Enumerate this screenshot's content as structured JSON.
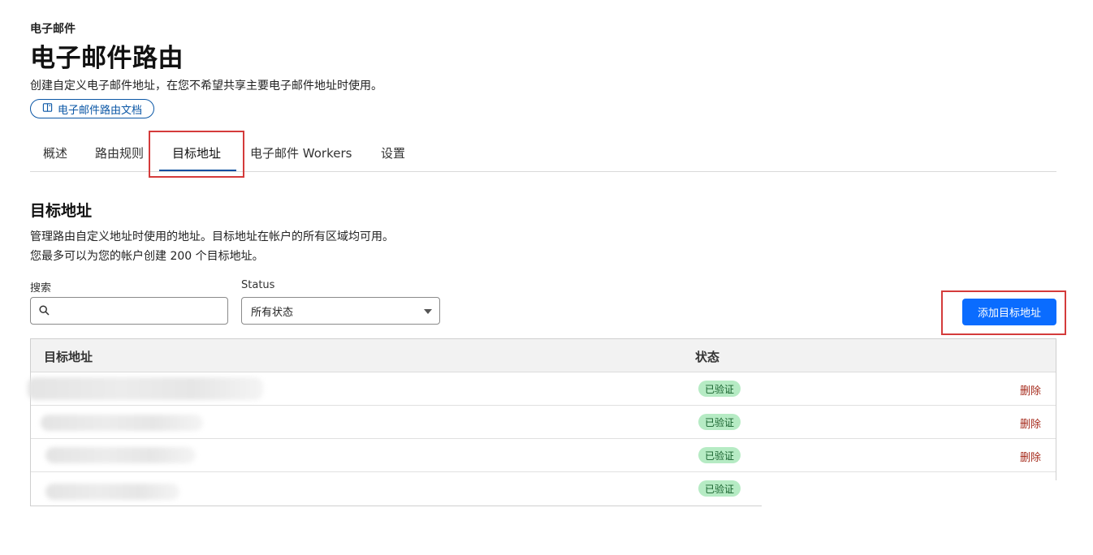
{
  "breadcrumb": "电子邮件",
  "title": "电子邮件路由",
  "description": "创建自定义电子邮件地址，在您不希望共享主要电子邮件地址时使用。",
  "docs_link": {
    "label": "电子邮件路由文档",
    "icon": "book-icon"
  },
  "tabs": [
    {
      "label": "概述",
      "active": false
    },
    {
      "label": "路由规则",
      "active": false
    },
    {
      "label": "目标地址",
      "active": true
    },
    {
      "label": "电子邮件 Workers",
      "active": false
    },
    {
      "label": "设置",
      "active": false
    }
  ],
  "section": {
    "title": "目标地址",
    "desc_line1": "管理路由自定义地址时使用的地址。目标地址在帐户的所有区域均可用。",
    "desc_line2": "您最多可以为您的帐户创建 200 个目标地址。"
  },
  "filters": {
    "search_label": "搜索",
    "search_value": "",
    "status_label": "Status",
    "status_selected": "所有状态"
  },
  "add_button_label": "添加目标地址",
  "table": {
    "columns": [
      "目标地址",
      "状态"
    ],
    "rows": [
      {
        "address": "",
        "status": "已验证",
        "action": "删除"
      },
      {
        "address": "",
        "status": "已验证",
        "action": "删除"
      },
      {
        "address": "",
        "status": "已验证",
        "action": "删除"
      },
      {
        "address": "",
        "status": "已验证",
        "action": ""
      }
    ]
  },
  "colors": {
    "primary": "#0a6cff",
    "link": "#0b57a6",
    "tab_underline": "#0b4fa0",
    "badge_bg": "#b6ebc4",
    "badge_text": "#17622d",
    "delete": "#a52a1b",
    "annotation": "#d43b3b"
  }
}
